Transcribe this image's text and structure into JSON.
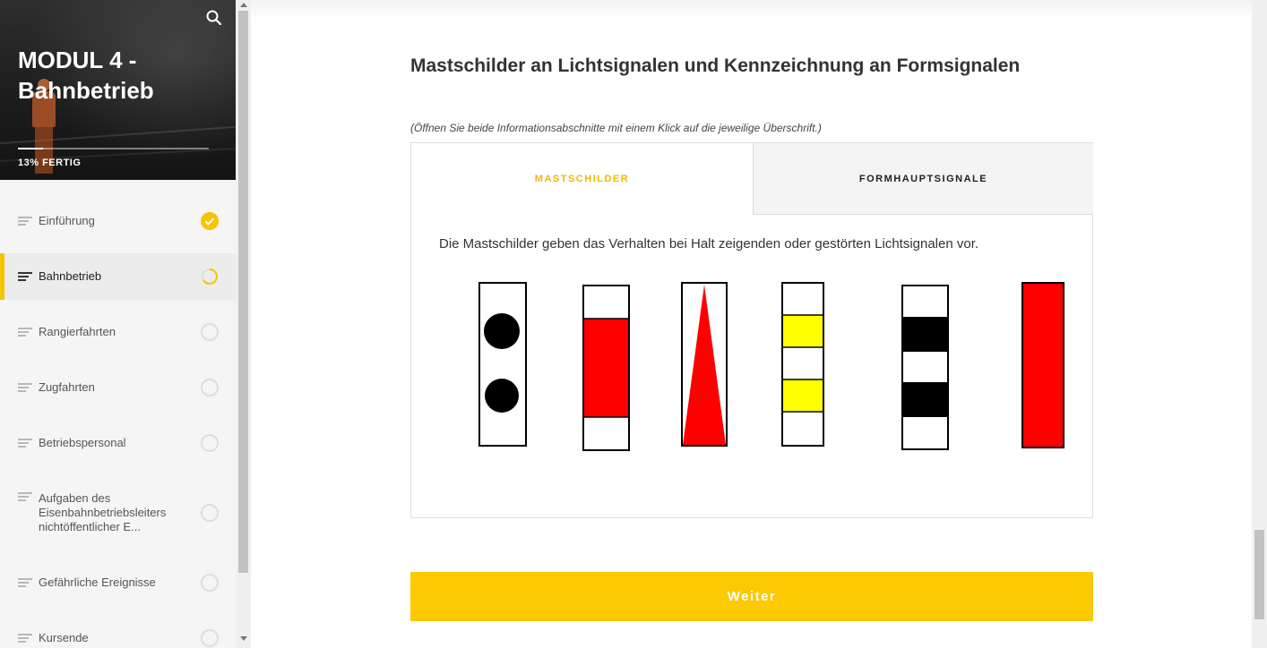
{
  "sidebar": {
    "module_title": "MODUL 4 - Bahnbetrieb",
    "progress_text": "13% FERTIG",
    "progress_fraction": 0.13,
    "search_icon": "search-icon",
    "items": [
      {
        "label": "Einführung",
        "status": "done"
      },
      {
        "label": "Bahnbetrieb",
        "status": "in-progress",
        "active": true
      },
      {
        "label": "Rangierfahrten",
        "status": "open"
      },
      {
        "label": "Zugfahrten",
        "status": "open"
      },
      {
        "label": "Betriebspersonal",
        "status": "open"
      },
      {
        "label": "Aufgaben des Eisenbahnbetriebsleiters nichtöffentlicher E...",
        "status": "open"
      },
      {
        "label": "Gefährliche Ereignisse",
        "status": "open"
      },
      {
        "label": "Kursende",
        "status": "open"
      }
    ]
  },
  "main": {
    "title": "Mastschilder an Lichtsignalen und Kennzeichnung an Formsignalen",
    "hint": "(Öffnen Sie beide Informationsabschnitte mit einem Klick auf die jeweilige Überschrift.)",
    "tabs": [
      {
        "label": "MASTSCHILDER",
        "selected": true
      },
      {
        "label": "FORMHAUPTSIGNALE",
        "selected": false
      }
    ],
    "tab_content": "Die Mastschilder geben das Verhalten bei Halt zeigenden oder gestörten Lichtsignalen vor.",
    "button_label": "Weiter"
  },
  "colors": {
    "accent": "#fdc900",
    "tab_active_text": "#f2b705",
    "sign_red": "#ff0000",
    "sign_yellow": "#ffff00",
    "sign_black": "#000000"
  }
}
